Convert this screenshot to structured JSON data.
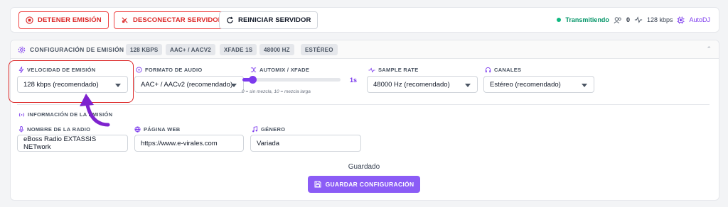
{
  "toolbar": {
    "stop_label": "DETENER EMISIÓN",
    "disconnect_label": "DESCONECTAR SERVIDOR",
    "restart_label": "REINICIAR SERVIDOR",
    "status_text": "Transmitiendo",
    "listeners": "0",
    "bitrate": "128 kbps",
    "autodj": "AutoDJ",
    "status_color": "#10b981"
  },
  "config": {
    "title": "CONFIGURACIÓN DE EMISIÓN",
    "chips": [
      "128 KBPS",
      "AAC+ / AACV2",
      "XFADE 1S",
      "48000 HZ",
      "ESTÉREO"
    ],
    "bitrate": {
      "label": "VELOCIDAD DE EMISIÓN",
      "value": "128 kbps (recomendado)"
    },
    "format": {
      "label": "FORMATO DE AUDIO",
      "value": "AAC+ / AACv2 (recomendado)"
    },
    "xfade": {
      "label": "AUTOMIX / XFADE",
      "value": "1s",
      "fraction": 0.1,
      "hint": "0 = sin mezcla, 10 = mezcla larga"
    },
    "samplerate": {
      "label": "SAMPLE RATE",
      "value": "48000 Hz (recomendado)"
    },
    "channels": {
      "label": "CANALES",
      "value": "Estéreo (recomendado)"
    }
  },
  "info": {
    "section_title": "INFORMACIÓN DE LA EMISIÓN",
    "radio_name": {
      "label": "NOMBRE DE LA RADIO",
      "value": "eBoss Radio EXTASSIS NETwork"
    },
    "website": {
      "label": "PÁGINA WEB",
      "value": "https://www.e-virales.com"
    },
    "genre": {
      "label": "GÉNERO",
      "value": "Variada"
    }
  },
  "footer": {
    "saved_text": "Guardado",
    "save_label": "GUARDAR CONFIGURACIÓN"
  },
  "colors": {
    "accent": "#8b5cf6",
    "danger": "#dc2626"
  }
}
